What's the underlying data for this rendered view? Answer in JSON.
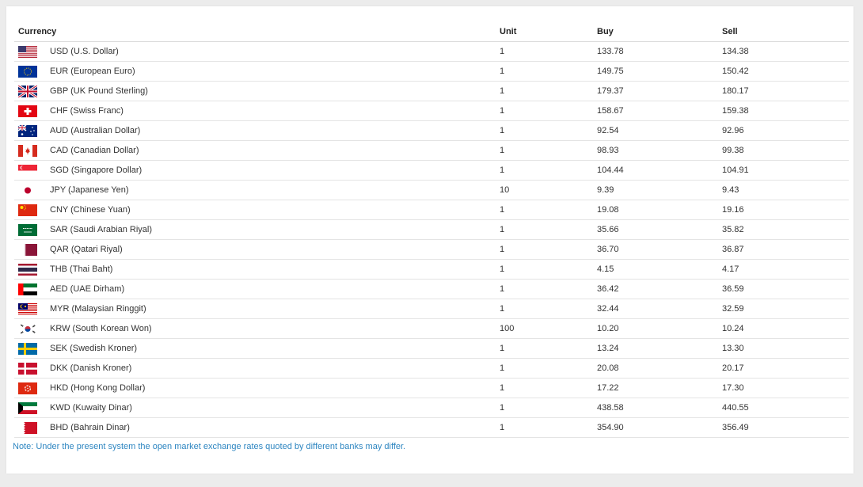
{
  "table": {
    "headers": {
      "currency": "Currency",
      "unit": "Unit",
      "buy": "Buy",
      "sell": "Sell"
    },
    "rows": [
      {
        "flag": "us-flag-icon",
        "currency": "USD (U.S. Dollar)",
        "unit": "1",
        "buy": "133.78",
        "sell": "134.38"
      },
      {
        "flag": "eu-flag-icon",
        "currency": "EUR (European Euro)",
        "unit": "1",
        "buy": "149.75",
        "sell": "150.42"
      },
      {
        "flag": "uk-flag-icon",
        "currency": "GBP (UK Pound Sterling)",
        "unit": "1",
        "buy": "179.37",
        "sell": "180.17"
      },
      {
        "flag": "ch-flag-icon",
        "currency": "CHF (Swiss Franc)",
        "unit": "1",
        "buy": "158.67",
        "sell": "159.38"
      },
      {
        "flag": "au-flag-icon",
        "currency": "AUD (Australian Dollar)",
        "unit": "1",
        "buy": "92.54",
        "sell": "92.96"
      },
      {
        "flag": "ca-flag-icon",
        "currency": "CAD (Canadian Dollar)",
        "unit": "1",
        "buy": "98.93",
        "sell": "99.38"
      },
      {
        "flag": "sg-flag-icon",
        "currency": "SGD (Singapore Dollar)",
        "unit": "1",
        "buy": "104.44",
        "sell": "104.91"
      },
      {
        "flag": "jp-flag-icon",
        "currency": "JPY (Japanese Yen)",
        "unit": "10",
        "buy": "9.39",
        "sell": "9.43"
      },
      {
        "flag": "cn-flag-icon",
        "currency": "CNY (Chinese Yuan)",
        "unit": "1",
        "buy": "19.08",
        "sell": "19.16"
      },
      {
        "flag": "sa-flag-icon",
        "currency": "SAR (Saudi Arabian Riyal)",
        "unit": "1",
        "buy": "35.66",
        "sell": "35.82"
      },
      {
        "flag": "qa-flag-icon",
        "currency": "QAR (Qatari Riyal)",
        "unit": "1",
        "buy": "36.70",
        "sell": "36.87"
      },
      {
        "flag": "th-flag-icon",
        "currency": "THB (Thai Baht)",
        "unit": "1",
        "buy": "4.15",
        "sell": "4.17"
      },
      {
        "flag": "ae-flag-icon",
        "currency": "AED (UAE Dirham)",
        "unit": "1",
        "buy": "36.42",
        "sell": "36.59"
      },
      {
        "flag": "my-flag-icon",
        "currency": "MYR (Malaysian Ringgit)",
        "unit": "1",
        "buy": "32.44",
        "sell": "32.59"
      },
      {
        "flag": "kr-flag-icon",
        "currency": "KRW (South Korean Won)",
        "unit": "100",
        "buy": "10.20",
        "sell": "10.24"
      },
      {
        "flag": "se-flag-icon",
        "currency": "SEK (Swedish Kroner)",
        "unit": "1",
        "buy": "13.24",
        "sell": "13.30"
      },
      {
        "flag": "dk-flag-icon",
        "currency": "DKK (Danish Kroner)",
        "unit": "1",
        "buy": "20.08",
        "sell": "20.17"
      },
      {
        "flag": "hk-flag-icon",
        "currency": "HKD (Hong Kong Dollar)",
        "unit": "1",
        "buy": "17.22",
        "sell": "17.30"
      },
      {
        "flag": "kw-flag-icon",
        "currency": "KWD (Kuwaity Dinar)",
        "unit": "1",
        "buy": "438.58",
        "sell": "440.55"
      },
      {
        "flag": "bh-flag-icon",
        "currency": "BHD (Bahrain Dinar)",
        "unit": "1",
        "buy": "354.90",
        "sell": "356.49"
      }
    ]
  },
  "note": "Note: Under the present system the open market exchange rates quoted by different banks may differ.",
  "colors": {
    "note": "#2e86c1",
    "row_border": "#e4e4e4",
    "background": "#ececec"
  }
}
